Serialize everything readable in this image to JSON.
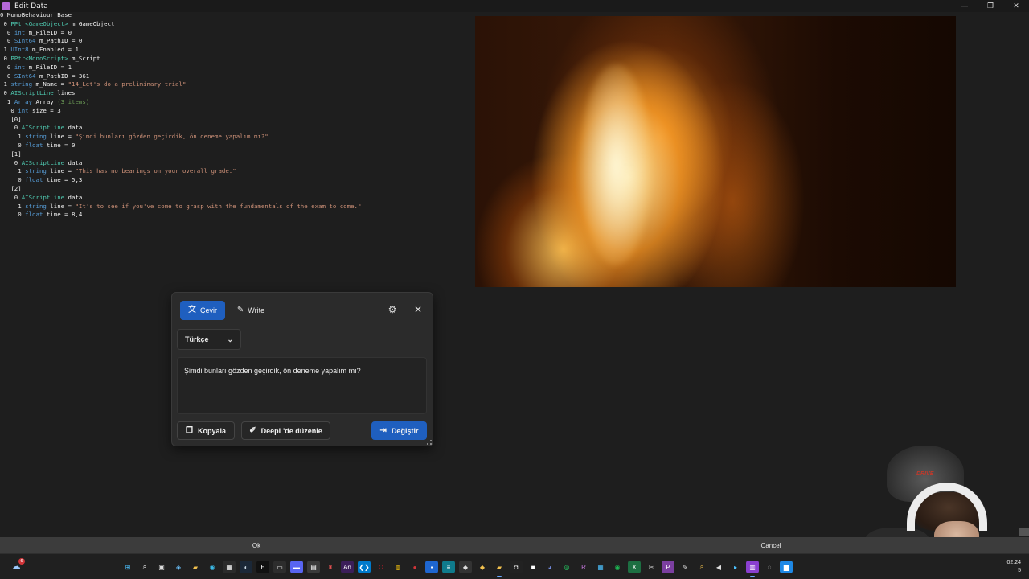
{
  "window": {
    "title": "Edit Data",
    "controls": [
      "—",
      "❐",
      "✕"
    ]
  },
  "tree": {
    "rows": [
      [
        [
          "num",
          "0 "
        ],
        [
          "fname",
          "MonoBehaviour Base"
        ]
      ],
      [
        [
          "num",
          " 0 "
        ],
        [
          "type",
          "PPtr<GameObject>"
        ],
        [
          "fname",
          " m_GameObject"
        ]
      ],
      [
        [
          "num",
          "  0 "
        ],
        [
          "kw",
          "int"
        ],
        [
          "fname",
          " m_FileID = 0"
        ]
      ],
      [
        [
          "num",
          "  0 "
        ],
        [
          "kw",
          "SInt64"
        ],
        [
          "fname",
          " m_PathID = 0"
        ]
      ],
      [
        [
          "num",
          " 1 "
        ],
        [
          "kw",
          "UInt8"
        ],
        [
          "fname",
          " m_Enabled = 1"
        ]
      ],
      [
        [
          "num",
          " 0 "
        ],
        [
          "type",
          "PPtr<MonoScript>"
        ],
        [
          "fname",
          " m_Script"
        ]
      ],
      [
        [
          "num",
          "  0 "
        ],
        [
          "kw",
          "int"
        ],
        [
          "fname",
          " m_FileID = 1"
        ]
      ],
      [
        [
          "num",
          "  0 "
        ],
        [
          "kw",
          "SInt64"
        ],
        [
          "fname",
          " m_PathID = 361"
        ]
      ],
      [
        [
          "num",
          " 1 "
        ],
        [
          "kw",
          "string"
        ],
        [
          "fname",
          " m_Name = "
        ],
        [
          "str",
          "\"14_Let's do a preliminary trial\""
        ]
      ],
      [
        [
          "num",
          " 0 "
        ],
        [
          "type",
          "AIScriptLine"
        ],
        [
          "fname",
          " lines"
        ]
      ],
      [
        [
          "num",
          "  1 "
        ],
        [
          "kw",
          "Array"
        ],
        [
          "fname",
          " Array "
        ],
        [
          "cnt",
          "(3 items)"
        ]
      ],
      [
        [
          "num",
          "   0 "
        ],
        [
          "kw",
          "int"
        ],
        [
          "fname",
          " size = 3"
        ]
      ],
      [
        [
          "fname",
          "   [0]"
        ]
      ],
      [
        [
          "num",
          "    0 "
        ],
        [
          "type",
          "AIScriptLine"
        ],
        [
          "fname",
          " data"
        ]
      ],
      [
        [
          "num",
          "     1 "
        ],
        [
          "kw",
          "string"
        ],
        [
          "fname",
          " line = "
        ],
        [
          "str",
          "\"Şimdi bunları gözden geçirdik, ön deneme yapalım mı?\""
        ]
      ],
      [
        [
          "num",
          "     0 "
        ],
        [
          "kw",
          "float"
        ],
        [
          "fname",
          " time = 0"
        ]
      ],
      [
        [
          "fname",
          "   [1]"
        ]
      ],
      [
        [
          "num",
          "    0 "
        ],
        [
          "type",
          "AIScriptLine"
        ],
        [
          "fname",
          " data"
        ]
      ],
      [
        [
          "num",
          "     1 "
        ],
        [
          "kw",
          "string"
        ],
        [
          "fname",
          " line = "
        ],
        [
          "str",
          "\"This has no bearings on your overall grade.\""
        ]
      ],
      [
        [
          "num",
          "     0 "
        ],
        [
          "kw",
          "float"
        ],
        [
          "fname",
          " time = 5,3"
        ]
      ],
      [
        [
          "fname",
          "   [2]"
        ]
      ],
      [
        [
          "num",
          "    0 "
        ],
        [
          "type",
          "AIScriptLine"
        ],
        [
          "fname",
          " data"
        ]
      ],
      [
        [
          "num",
          "     1 "
        ],
        [
          "kw",
          "string"
        ],
        [
          "fname",
          " line = "
        ],
        [
          "str",
          "\"It's to see if you've come to grasp with the fundamentals of the exam to come.\""
        ]
      ],
      [
        [
          "num",
          "     0 "
        ],
        [
          "kw",
          "float"
        ],
        [
          "fname",
          " time = 8,4"
        ]
      ]
    ]
  },
  "popup": {
    "tab_translate": "Çevir",
    "tab_write": "Write",
    "language": "Türkçe",
    "result_text": "Şimdi bunları gözden geçirdik, ön deneme yapalım mı?",
    "copy_label": "Kopyala",
    "deepl_label": "DeepL'de düzenle",
    "replace_label": "Değiştir"
  },
  "webcam": {
    "cap_logo": "DRIVE"
  },
  "dialog": {
    "ok_label": "Ok",
    "cancel_label": "Cancel"
  },
  "taskbar": {
    "notification_count": "6",
    "clock_time": "02:24",
    "clock_date": "5",
    "icons": [
      {
        "name": "start-icon",
        "glyph": "⊞",
        "color": "#4cc2ff",
        "bg": "transparent",
        "active": false
      },
      {
        "name": "search-icon",
        "glyph": "⌕",
        "color": "#ffffff",
        "bg": "transparent",
        "active": false
      },
      {
        "name": "task-view-icon",
        "glyph": "▣",
        "color": "#dddddd",
        "bg": "transparent",
        "active": false
      },
      {
        "name": "widgets-icon",
        "glyph": "◈",
        "color": "#6cc3ff",
        "bg": "transparent",
        "active": false
      },
      {
        "name": "file-explorer-icon",
        "glyph": "▰",
        "color": "#f2c14e",
        "bg": "transparent",
        "active": false
      },
      {
        "name": "edge-icon",
        "glyph": "◉",
        "color": "#3bb9e6",
        "bg": "transparent",
        "active": false
      },
      {
        "name": "store-icon",
        "glyph": "▦",
        "color": "#ffffff",
        "bg": "#2b2b2b",
        "active": false
      },
      {
        "name": "steam-icon",
        "glyph": "◐",
        "color": "#c6d4df",
        "bg": "#1b2838",
        "active": false
      },
      {
        "name": "epic-icon",
        "glyph": "E",
        "color": "#ffffff",
        "bg": "#111111",
        "active": false
      },
      {
        "name": "terminal-icon",
        "glyph": "▭",
        "color": "#ffffff",
        "bg": "#2d2d2d",
        "active": false
      },
      {
        "name": "chat-icon",
        "glyph": "▬",
        "color": "#ffffff",
        "bg": "#5865f2",
        "active": false
      },
      {
        "name": "notepad-icon",
        "glyph": "▤",
        "color": "#ffffff",
        "bg": "#3a3a3a",
        "active": false
      },
      {
        "name": "game-icon",
        "glyph": "♜",
        "color": "#e05050",
        "bg": "transparent",
        "active": false
      },
      {
        "name": "animate-icon",
        "glyph": "An",
        "color": "#ffffff",
        "bg": "#3b1e59",
        "active": false
      },
      {
        "name": "vscode-icon",
        "glyph": "❮❯",
        "color": "#ffffff",
        "bg": "#007acc",
        "active": false
      },
      {
        "name": "opera-icon",
        "glyph": "O",
        "color": "#ff1b2d",
        "bg": "transparent",
        "active": false
      },
      {
        "name": "chrome-icon",
        "glyph": "◍",
        "color": "#f4c20d",
        "bg": "transparent",
        "active": false
      },
      {
        "name": "pin-icon",
        "glyph": "●",
        "color": "#d13438",
        "bg": "transparent",
        "active": false
      },
      {
        "name": "app-blue-icon",
        "glyph": "▪",
        "color": "#ffffff",
        "bg": "#1e66d0",
        "active": false
      },
      {
        "name": "app-teal-icon",
        "glyph": "≡",
        "color": "#ffffff",
        "bg": "#0f7b8c",
        "active": false
      },
      {
        "name": "app-dark-icon",
        "glyph": "◆",
        "color": "#dddddd",
        "bg": "#333333",
        "active": false
      },
      {
        "name": "shield-icon",
        "glyph": "◆",
        "color": "#f2c14e",
        "bg": "transparent",
        "active": false
      },
      {
        "name": "folder-icon",
        "glyph": "▰",
        "color": "#f2c14e",
        "bg": "transparent",
        "active": true
      },
      {
        "name": "photos-icon",
        "glyph": "◘",
        "color": "#ffffff",
        "bg": "#222222",
        "active": false
      },
      {
        "name": "paint-icon",
        "glyph": "■",
        "color": "#ffffff",
        "bg": "transparent",
        "active": false
      },
      {
        "name": "discord-icon",
        "glyph": "◕",
        "color": "#7289da",
        "bg": "transparent",
        "active": false
      },
      {
        "name": "whatsapp-icon",
        "glyph": "◎",
        "color": "#25d366",
        "bg": "transparent",
        "active": false
      },
      {
        "name": "app-r-icon",
        "glyph": "R",
        "color": "#c678dd",
        "bg": "transparent",
        "active": false
      },
      {
        "name": "app-grid-icon",
        "glyph": "▦",
        "color": "#4cc2ff",
        "bg": "transparent",
        "active": false
      },
      {
        "name": "spotify-icon",
        "glyph": "◉",
        "color": "#1db954",
        "bg": "transparent",
        "active": false
      },
      {
        "name": "excel-icon",
        "glyph": "X",
        "color": "#ffffff",
        "bg": "#1d6f42",
        "active": false
      },
      {
        "name": "app-k-icon",
        "glyph": "✂",
        "color": "#dddddd",
        "bg": "transparent",
        "active": false
      },
      {
        "name": "app-p-icon",
        "glyph": "P",
        "color": "#ffffff",
        "bg": "#7b3fa0",
        "active": false
      },
      {
        "name": "snipping-icon",
        "glyph": "✎",
        "color": "#dddddd",
        "bg": "transparent",
        "active": false
      },
      {
        "name": "magnifier-icon",
        "glyph": "⌕",
        "color": "#f2c14e",
        "bg": "transparent",
        "active": false
      },
      {
        "name": "back-icon",
        "glyph": "◀",
        "color": "#dddddd",
        "bg": "transparent",
        "active": false
      },
      {
        "name": "app-arrow-icon",
        "glyph": "▸",
        "color": "#4cc2ff",
        "bg": "transparent",
        "active": false
      },
      {
        "name": "editdata-icon",
        "glyph": "▥",
        "color": "#ffffff",
        "bg": "#8a3fd0",
        "active": true
      },
      {
        "name": "app-spiral-icon",
        "glyph": "◌",
        "color": "#dddddd",
        "bg": "transparent",
        "active": false
      },
      {
        "name": "app-blue2-icon",
        "glyph": "▆",
        "color": "#ffffff",
        "bg": "#1e88e5",
        "active": false
      }
    ]
  }
}
